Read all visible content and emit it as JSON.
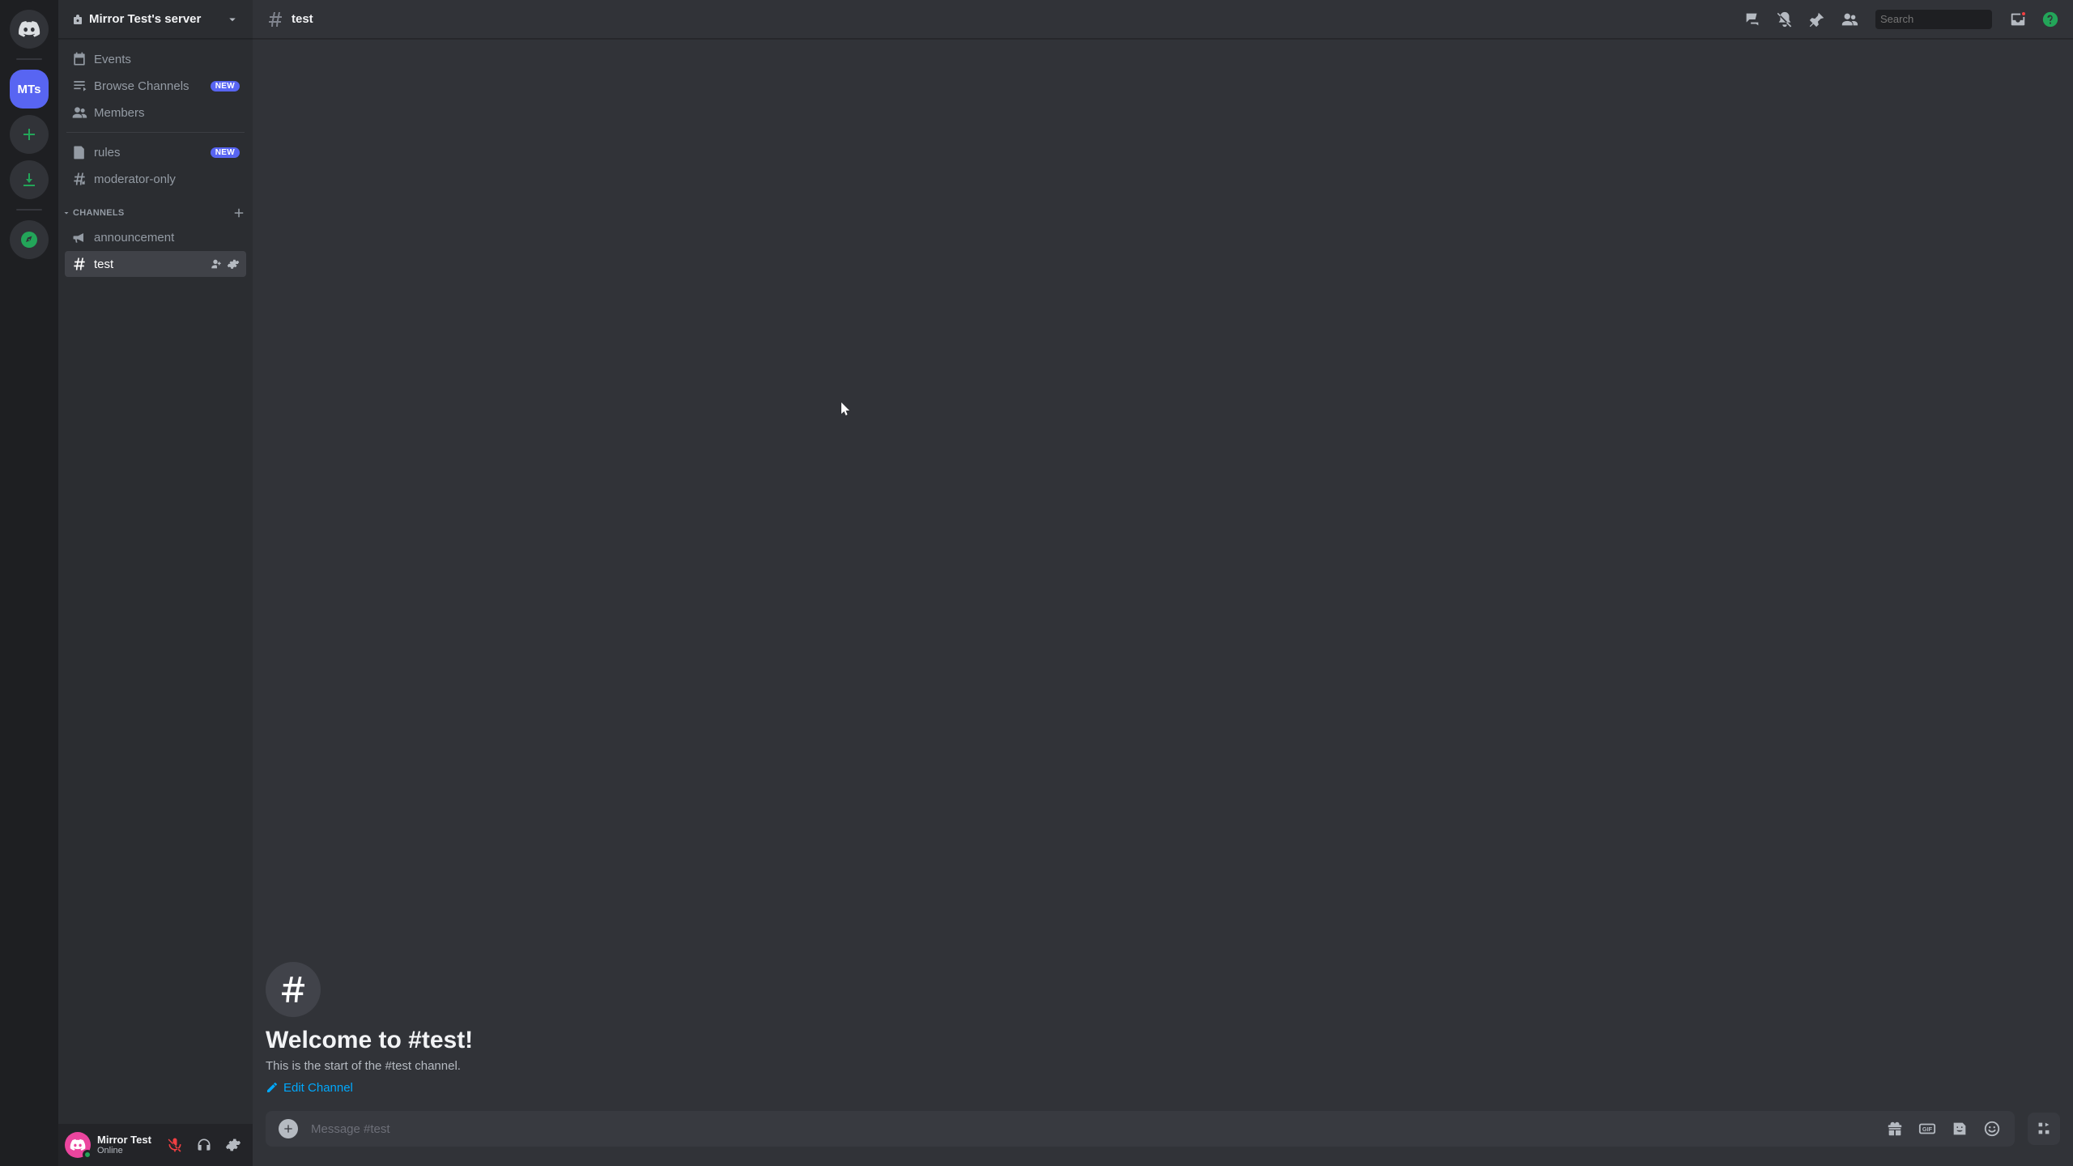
{
  "guilds": {
    "selected_initials": "MTs"
  },
  "server": {
    "name": "Mirror Test's server"
  },
  "sidebar": {
    "top_items": [
      {
        "label": "Events"
      },
      {
        "label": "Browse Channels",
        "badge": "NEW"
      },
      {
        "label": "Members"
      }
    ],
    "special_channels": [
      {
        "label": "rules",
        "badge": "NEW"
      },
      {
        "label": "moderator-only"
      }
    ],
    "category_label": "CHANNELS",
    "channels": [
      {
        "label": "announcement"
      },
      {
        "label": "test",
        "active": true
      }
    ]
  },
  "user": {
    "name": "Mirror Test",
    "status": "Online"
  },
  "header": {
    "channel_name": "test",
    "search_placeholder": "Search"
  },
  "welcome": {
    "title": "Welcome to #test!",
    "subtitle": "This is the start of the #test channel.",
    "edit_label": "Edit Channel"
  },
  "composer": {
    "placeholder": "Message #test"
  }
}
